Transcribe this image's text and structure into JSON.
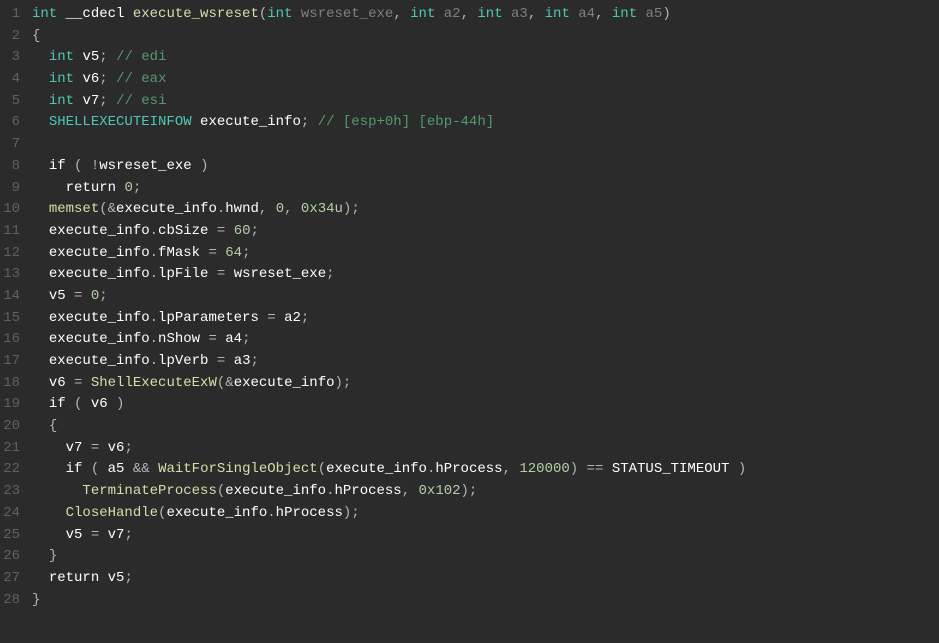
{
  "code": {
    "lines": [
      {
        "n": 1,
        "tokens": [
          {
            "t": "int",
            "c": "t-type"
          },
          {
            "t": " ",
            "c": ""
          },
          {
            "t": "__cdecl",
            "c": "t-keyword"
          },
          {
            "t": " ",
            "c": ""
          },
          {
            "t": "execute_wsreset",
            "c": "t-func"
          },
          {
            "t": "(",
            "c": "t-paren"
          },
          {
            "t": "int",
            "c": "t-type"
          },
          {
            "t": " ",
            "c": ""
          },
          {
            "t": "wsreset_exe",
            "c": "t-param"
          },
          {
            "t": ", ",
            "c": "t-punct"
          },
          {
            "t": "int",
            "c": "t-type"
          },
          {
            "t": " ",
            "c": ""
          },
          {
            "t": "a2",
            "c": "t-param"
          },
          {
            "t": ", ",
            "c": "t-punct"
          },
          {
            "t": "int",
            "c": "t-type"
          },
          {
            "t": " ",
            "c": ""
          },
          {
            "t": "a3",
            "c": "t-param"
          },
          {
            "t": ", ",
            "c": "t-punct"
          },
          {
            "t": "int",
            "c": "t-type"
          },
          {
            "t": " ",
            "c": ""
          },
          {
            "t": "a4",
            "c": "t-param"
          },
          {
            "t": ", ",
            "c": "t-punct"
          },
          {
            "t": "int",
            "c": "t-type"
          },
          {
            "t": " ",
            "c": ""
          },
          {
            "t": "a5",
            "c": "t-param"
          },
          {
            "t": ")",
            "c": "t-paren"
          }
        ]
      },
      {
        "n": 2,
        "tokens": [
          {
            "t": "{",
            "c": "t-punct"
          }
        ]
      },
      {
        "n": 3,
        "tokens": [
          {
            "t": "  ",
            "c": ""
          },
          {
            "t": "int",
            "c": "t-type"
          },
          {
            "t": " ",
            "c": ""
          },
          {
            "t": "v5",
            "c": "t-var"
          },
          {
            "t": "; ",
            "c": "t-punct"
          },
          {
            "t": "// edi",
            "c": "t-comment"
          }
        ]
      },
      {
        "n": 4,
        "tokens": [
          {
            "t": "  ",
            "c": ""
          },
          {
            "t": "int",
            "c": "t-type"
          },
          {
            "t": " ",
            "c": ""
          },
          {
            "t": "v6",
            "c": "t-var"
          },
          {
            "t": "; ",
            "c": "t-punct"
          },
          {
            "t": "// eax",
            "c": "t-comment"
          }
        ]
      },
      {
        "n": 5,
        "tokens": [
          {
            "t": "  ",
            "c": ""
          },
          {
            "t": "int",
            "c": "t-type"
          },
          {
            "t": " ",
            "c": ""
          },
          {
            "t": "v7",
            "c": "t-var"
          },
          {
            "t": "; ",
            "c": "t-punct"
          },
          {
            "t": "// esi",
            "c": "t-comment"
          }
        ]
      },
      {
        "n": 6,
        "tokens": [
          {
            "t": "  ",
            "c": ""
          },
          {
            "t": "SHELLEXECUTEINFOW",
            "c": "t-type"
          },
          {
            "t": " ",
            "c": ""
          },
          {
            "t": "execute_info",
            "c": "t-var"
          },
          {
            "t": "; ",
            "c": "t-punct"
          },
          {
            "t": "// [esp+0h] [ebp-44h]",
            "c": "t-comment"
          }
        ]
      },
      {
        "n": 7,
        "tokens": []
      },
      {
        "n": 8,
        "tokens": [
          {
            "t": "  ",
            "c": ""
          },
          {
            "t": "if",
            "c": "t-keyword"
          },
          {
            "t": " ",
            "c": ""
          },
          {
            "t": "( !",
            "c": "t-paren"
          },
          {
            "t": "wsreset_exe",
            "c": "t-var"
          },
          {
            "t": " )",
            "c": "t-paren"
          }
        ]
      },
      {
        "n": 9,
        "tokens": [
          {
            "t": "    ",
            "c": ""
          },
          {
            "t": "return",
            "c": "t-keyword"
          },
          {
            "t": " ",
            "c": ""
          },
          {
            "t": "0",
            "c": "t-num"
          },
          {
            "t": ";",
            "c": "t-punct"
          }
        ]
      },
      {
        "n": 10,
        "tokens": [
          {
            "t": "  ",
            "c": ""
          },
          {
            "t": "memset",
            "c": "t-func"
          },
          {
            "t": "(&",
            "c": "t-paren"
          },
          {
            "t": "execute_info",
            "c": "t-var"
          },
          {
            "t": ".",
            "c": "t-punct"
          },
          {
            "t": "hwnd",
            "c": "t-member"
          },
          {
            "t": ", ",
            "c": "t-punct"
          },
          {
            "t": "0",
            "c": "t-num"
          },
          {
            "t": ", ",
            "c": "t-punct"
          },
          {
            "t": "0x34u",
            "c": "t-num"
          },
          {
            "t": ");",
            "c": "t-paren"
          }
        ]
      },
      {
        "n": 11,
        "tokens": [
          {
            "t": "  ",
            "c": ""
          },
          {
            "t": "execute_info",
            "c": "t-var"
          },
          {
            "t": ".",
            "c": "t-punct"
          },
          {
            "t": "cbSize",
            "c": "t-member"
          },
          {
            "t": " = ",
            "c": "t-op"
          },
          {
            "t": "60",
            "c": "t-num"
          },
          {
            "t": ";",
            "c": "t-punct"
          }
        ]
      },
      {
        "n": 12,
        "tokens": [
          {
            "t": "  ",
            "c": ""
          },
          {
            "t": "execute_info",
            "c": "t-var"
          },
          {
            "t": ".",
            "c": "t-punct"
          },
          {
            "t": "fMask",
            "c": "t-member"
          },
          {
            "t": " = ",
            "c": "t-op"
          },
          {
            "t": "64",
            "c": "t-num"
          },
          {
            "t": ";",
            "c": "t-punct"
          }
        ]
      },
      {
        "n": 13,
        "tokens": [
          {
            "t": "  ",
            "c": ""
          },
          {
            "t": "execute_info",
            "c": "t-var"
          },
          {
            "t": ".",
            "c": "t-punct"
          },
          {
            "t": "lpFile",
            "c": "t-member"
          },
          {
            "t": " = ",
            "c": "t-op"
          },
          {
            "t": "wsreset_exe",
            "c": "t-var"
          },
          {
            "t": ";",
            "c": "t-punct"
          }
        ]
      },
      {
        "n": 14,
        "tokens": [
          {
            "t": "  ",
            "c": ""
          },
          {
            "t": "v5",
            "c": "t-var"
          },
          {
            "t": " = ",
            "c": "t-op"
          },
          {
            "t": "0",
            "c": "t-num"
          },
          {
            "t": ";",
            "c": "t-punct"
          }
        ]
      },
      {
        "n": 15,
        "tokens": [
          {
            "t": "  ",
            "c": ""
          },
          {
            "t": "execute_info",
            "c": "t-var"
          },
          {
            "t": ".",
            "c": "t-punct"
          },
          {
            "t": "lpParameters",
            "c": "t-member"
          },
          {
            "t": " = ",
            "c": "t-op"
          },
          {
            "t": "a2",
            "c": "t-var"
          },
          {
            "t": ";",
            "c": "t-punct"
          }
        ]
      },
      {
        "n": 16,
        "tokens": [
          {
            "t": "  ",
            "c": ""
          },
          {
            "t": "execute_info",
            "c": "t-var"
          },
          {
            "t": ".",
            "c": "t-punct"
          },
          {
            "t": "nShow",
            "c": "t-member"
          },
          {
            "t": " = ",
            "c": "t-op"
          },
          {
            "t": "a4",
            "c": "t-var"
          },
          {
            "t": ";",
            "c": "t-punct"
          }
        ]
      },
      {
        "n": 17,
        "tokens": [
          {
            "t": "  ",
            "c": ""
          },
          {
            "t": "execute_info",
            "c": "t-var"
          },
          {
            "t": ".",
            "c": "t-punct"
          },
          {
            "t": "lpVerb",
            "c": "t-member"
          },
          {
            "t": " = ",
            "c": "t-op"
          },
          {
            "t": "a3",
            "c": "t-var"
          },
          {
            "t": ";",
            "c": "t-punct"
          }
        ]
      },
      {
        "n": 18,
        "tokens": [
          {
            "t": "  ",
            "c": ""
          },
          {
            "t": "v6",
            "c": "t-var"
          },
          {
            "t": " = ",
            "c": "t-op"
          },
          {
            "t": "ShellExecuteExW",
            "c": "t-func"
          },
          {
            "t": "(&",
            "c": "t-paren"
          },
          {
            "t": "execute_info",
            "c": "t-var"
          },
          {
            "t": ");",
            "c": "t-paren"
          }
        ]
      },
      {
        "n": 19,
        "tokens": [
          {
            "t": "  ",
            "c": ""
          },
          {
            "t": "if",
            "c": "t-keyword"
          },
          {
            "t": " ",
            "c": ""
          },
          {
            "t": "( ",
            "c": "t-paren"
          },
          {
            "t": "v6",
            "c": "t-var"
          },
          {
            "t": " )",
            "c": "t-paren"
          }
        ]
      },
      {
        "n": 20,
        "tokens": [
          {
            "t": "  ",
            "c": ""
          },
          {
            "t": "{",
            "c": "t-punct"
          }
        ]
      },
      {
        "n": 21,
        "tokens": [
          {
            "t": "    ",
            "c": ""
          },
          {
            "t": "v7",
            "c": "t-var"
          },
          {
            "t": " = ",
            "c": "t-op"
          },
          {
            "t": "v6",
            "c": "t-var"
          },
          {
            "t": ";",
            "c": "t-punct"
          }
        ]
      },
      {
        "n": 22,
        "tokens": [
          {
            "t": "    ",
            "c": ""
          },
          {
            "t": "if",
            "c": "t-keyword"
          },
          {
            "t": " ",
            "c": ""
          },
          {
            "t": "( ",
            "c": "t-paren"
          },
          {
            "t": "a5",
            "c": "t-var"
          },
          {
            "t": " && ",
            "c": "t-op"
          },
          {
            "t": "WaitForSingleObject",
            "c": "t-func"
          },
          {
            "t": "(",
            "c": "t-paren"
          },
          {
            "t": "execute_info",
            "c": "t-var"
          },
          {
            "t": ".",
            "c": "t-punct"
          },
          {
            "t": "hProcess",
            "c": "t-member"
          },
          {
            "t": ", ",
            "c": "t-punct"
          },
          {
            "t": "120000",
            "c": "t-num"
          },
          {
            "t": ") == ",
            "c": "t-paren"
          },
          {
            "t": "STATUS_TIMEOUT",
            "c": "t-white"
          },
          {
            "t": " )",
            "c": "t-paren"
          }
        ]
      },
      {
        "n": 23,
        "tokens": [
          {
            "t": "      ",
            "c": ""
          },
          {
            "t": "TerminateProcess",
            "c": "t-func"
          },
          {
            "t": "(",
            "c": "t-paren"
          },
          {
            "t": "execute_info",
            "c": "t-var"
          },
          {
            "t": ".",
            "c": "t-punct"
          },
          {
            "t": "hProcess",
            "c": "t-member"
          },
          {
            "t": ", ",
            "c": "t-punct"
          },
          {
            "t": "0x102",
            "c": "t-num"
          },
          {
            "t": ");",
            "c": "t-paren"
          }
        ]
      },
      {
        "n": 24,
        "tokens": [
          {
            "t": "    ",
            "c": ""
          },
          {
            "t": "CloseHandle",
            "c": "t-func"
          },
          {
            "t": "(",
            "c": "t-paren"
          },
          {
            "t": "execute_info",
            "c": "t-var"
          },
          {
            "t": ".",
            "c": "t-punct"
          },
          {
            "t": "hProcess",
            "c": "t-member"
          },
          {
            "t": ");",
            "c": "t-paren"
          }
        ]
      },
      {
        "n": 25,
        "tokens": [
          {
            "t": "    ",
            "c": ""
          },
          {
            "t": "v5",
            "c": "t-var"
          },
          {
            "t": " = ",
            "c": "t-op"
          },
          {
            "t": "v7",
            "c": "t-var"
          },
          {
            "t": ";",
            "c": "t-punct"
          }
        ]
      },
      {
        "n": 26,
        "tokens": [
          {
            "t": "  ",
            "c": ""
          },
          {
            "t": "}",
            "c": "t-punct"
          }
        ]
      },
      {
        "n": 27,
        "tokens": [
          {
            "t": "  ",
            "c": ""
          },
          {
            "t": "return",
            "c": "t-keyword"
          },
          {
            "t": " ",
            "c": ""
          },
          {
            "t": "v5",
            "c": "t-var"
          },
          {
            "t": ";",
            "c": "t-punct"
          }
        ]
      },
      {
        "n": 28,
        "tokens": [
          {
            "t": "}",
            "c": "t-punct"
          }
        ]
      }
    ]
  }
}
